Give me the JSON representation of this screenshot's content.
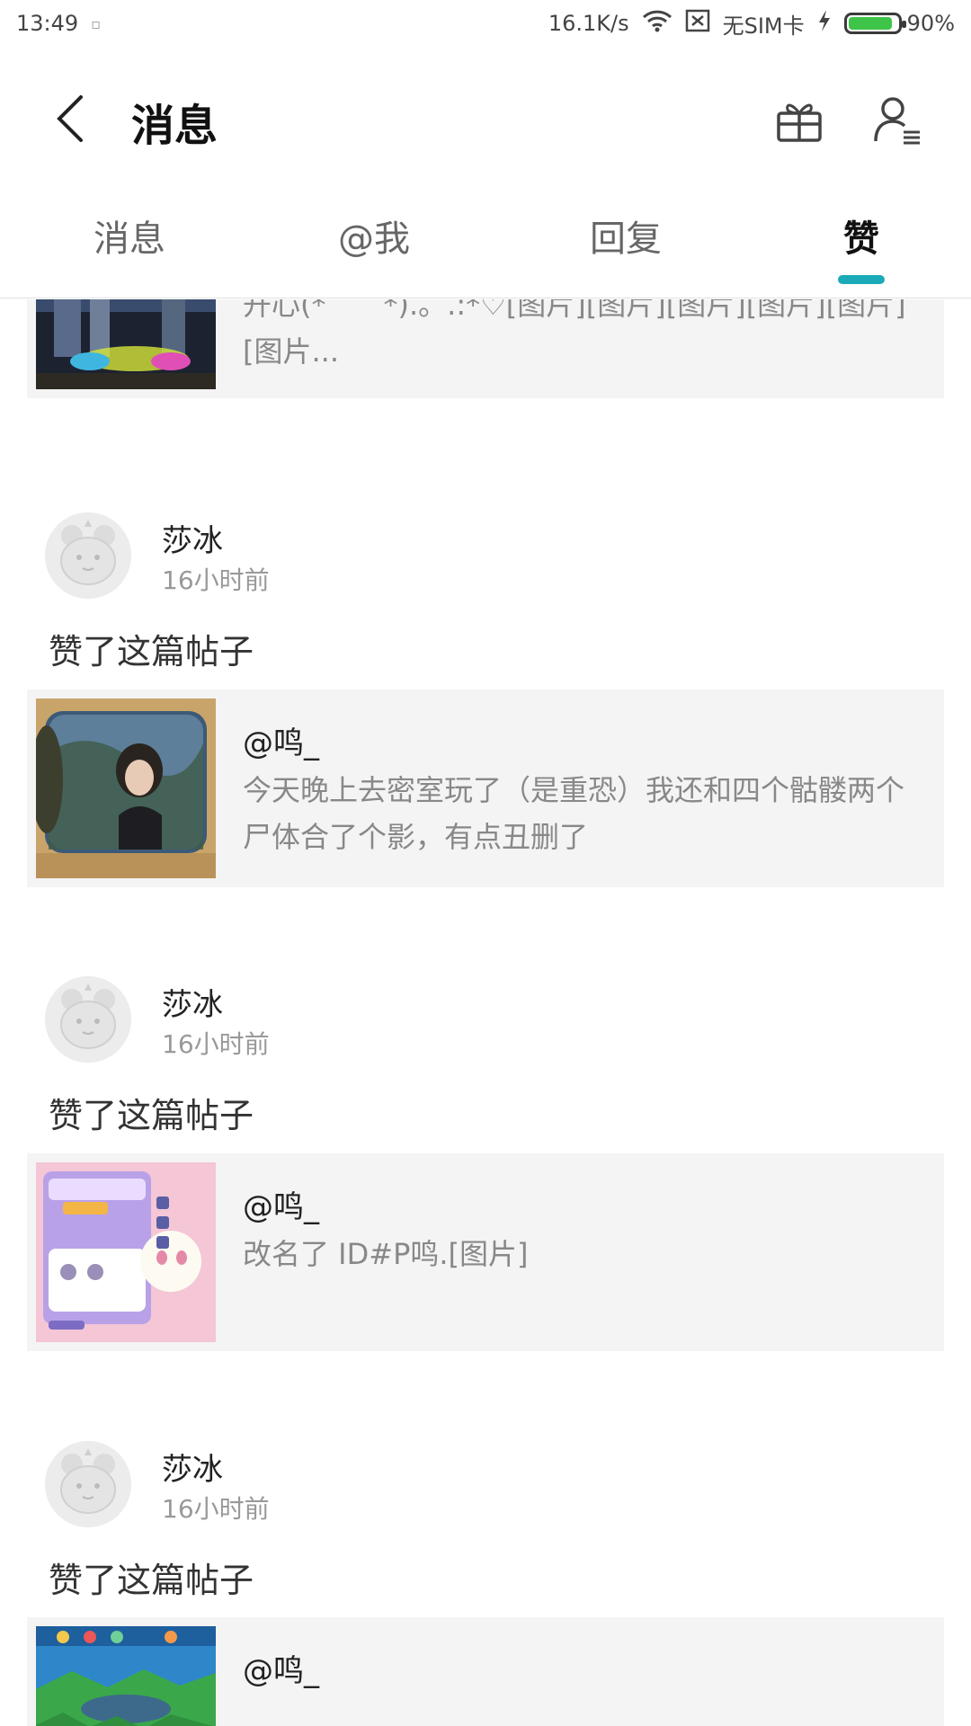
{
  "status": {
    "time": "13:49",
    "network_speed": "16.1K/s",
    "sim": "无SIM卡",
    "battery": "90%",
    "battery_level": 0.9
  },
  "header": {
    "title": "消息",
    "back_icon": "chevron-left-icon",
    "gift_icon": "gift-icon",
    "user_icon": "user-settings-icon"
  },
  "tabs": [
    {
      "label": "消息",
      "active": false
    },
    {
      "label": "@我",
      "active": false
    },
    {
      "label": "回复",
      "active": false
    },
    {
      "label": "赞",
      "active": true
    }
  ],
  "accent_color": "#1aaab8",
  "first_card": {
    "text": "开心(*ˇ︶ˇ*).。.:*♡[图片][图片][图片][图片][图片][图片..."
  },
  "items": [
    {
      "user": "莎冰",
      "time": "16小时前",
      "action": "赞了这篇帖子",
      "post_author": "@鸣_",
      "post_text": "今天晚上去密室玩了（是重恐）我还和四个骷髅两个尸体合了个影，有点丑删了"
    },
    {
      "user": "莎冰",
      "time": "16小时前",
      "action": "赞了这篇帖子",
      "post_author": "@鸣_",
      "post_text": "改名了 ID#P鸣.[图片]"
    },
    {
      "user": "莎冰",
      "time": "16小时前",
      "action": "赞了这篇帖子",
      "post_author": "@鸣_",
      "post_text": ""
    }
  ]
}
